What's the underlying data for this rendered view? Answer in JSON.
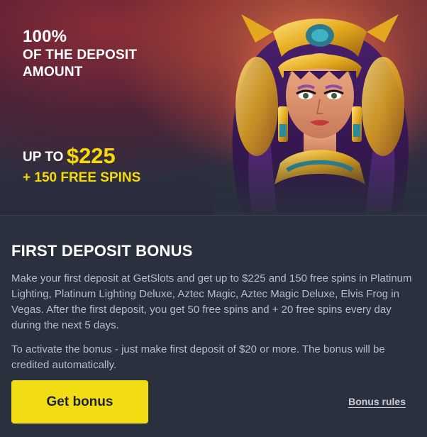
{
  "banner": {
    "percent": "100%",
    "headline_line1": "OF THE DEPOSIT",
    "headline_line2": "AMOUNT",
    "up_to": "UP TO",
    "amount": "$225",
    "free_spins": "+ 150 FREE SPINS",
    "image": "egyptian-queen-illustration"
  },
  "section": {
    "title": "FIRST DEPOSIT BONUS",
    "description": "Make your first deposit at GetSlots and get up to $225 and 150 free spins in Platinum Lighting, Platinum Lighting Deluxe, Aztec Magic, Aztec Magic Deluxe, Elvis Frog in Vegas. After the first deposit, you get 50 free spins and + 20 free spins every day during the next 5 days.",
    "activation_note": "To activate the bonus - just make first deposit of $20 or more. The bonus will be credited automatically."
  },
  "actions": {
    "get_bonus_label": "Get bonus",
    "bonus_rules_label": "Bonus rules"
  },
  "colors": {
    "accent_yellow": "#f2dc14",
    "background": "#2b303e",
    "text_muted": "#b8bcc6"
  }
}
